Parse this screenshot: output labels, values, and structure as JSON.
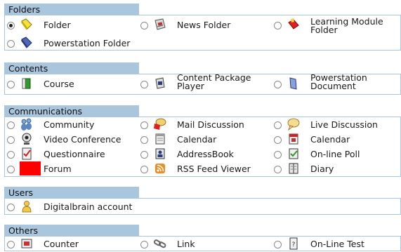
{
  "colors": {
    "header_bg": "#a9c6dd",
    "border": "#a9c6dd"
  },
  "sections": {
    "folders": {
      "title": "Folders",
      "items": [
        {
          "label": "Folder",
          "icon": "yellow-folder-icon",
          "selected": true
        },
        {
          "label": "News Folder",
          "icon": "news-folder-icon",
          "selected": false
        },
        {
          "label": "Learning Module Folder",
          "icon": "learning-module-folder-icon",
          "selected": false
        },
        {
          "label": "Powerstation Folder",
          "icon": "powerstation-folder-icon",
          "selected": false
        }
      ]
    },
    "contents": {
      "title": "Contents",
      "items": [
        {
          "label": "Course",
          "icon": "course-book-icon",
          "selected": false
        },
        {
          "label": "Content Package Player",
          "icon": "content-package-icon",
          "selected": false
        },
        {
          "label": "Powerstation Document",
          "icon": "powerstation-document-icon",
          "selected": false
        }
      ]
    },
    "communications": {
      "title": "Communications",
      "items": [
        {
          "label": "Community",
          "icon": "community-people-icon",
          "selected": false
        },
        {
          "label": "Mail Discussion",
          "icon": "mail-discussion-icon",
          "selected": false
        },
        {
          "label": "Live Discussion",
          "icon": "live-discussion-icon",
          "selected": false
        },
        {
          "label": "Video Conference",
          "icon": "webcam-icon",
          "selected": false
        },
        {
          "label": "Calendar",
          "icon": "calendar-icon",
          "selected": false
        },
        {
          "label": "Calendar",
          "icon": "calendar-red-icon",
          "selected": false
        },
        {
          "label": "Questionnaire",
          "icon": "questionnaire-icon",
          "selected": false
        },
        {
          "label": "AddressBook",
          "icon": "addressbook-icon",
          "selected": false
        },
        {
          "label": "On-line Poll",
          "icon": "poll-icon",
          "selected": false
        },
        {
          "label": "Forum",
          "icon": "forum-red-square-icon",
          "selected": false
        },
        {
          "label": "RSS Feed Viewer",
          "icon": "rss-feed-icon",
          "selected": false
        },
        {
          "label": "Diary",
          "icon": "diary-icon",
          "selected": false
        }
      ]
    },
    "users": {
      "title": "Users",
      "items": [
        {
          "label": "Digitalbrain account",
          "icon": "user-account-icon",
          "selected": false
        }
      ]
    },
    "others": {
      "title": "Others",
      "items": [
        {
          "label": "Counter",
          "icon": "counter-icon",
          "selected": false
        },
        {
          "label": "Link",
          "icon": "link-chain-icon",
          "selected": false
        },
        {
          "label": "On-Line Test",
          "icon": "online-test-icon",
          "selected": false
        }
      ]
    }
  }
}
